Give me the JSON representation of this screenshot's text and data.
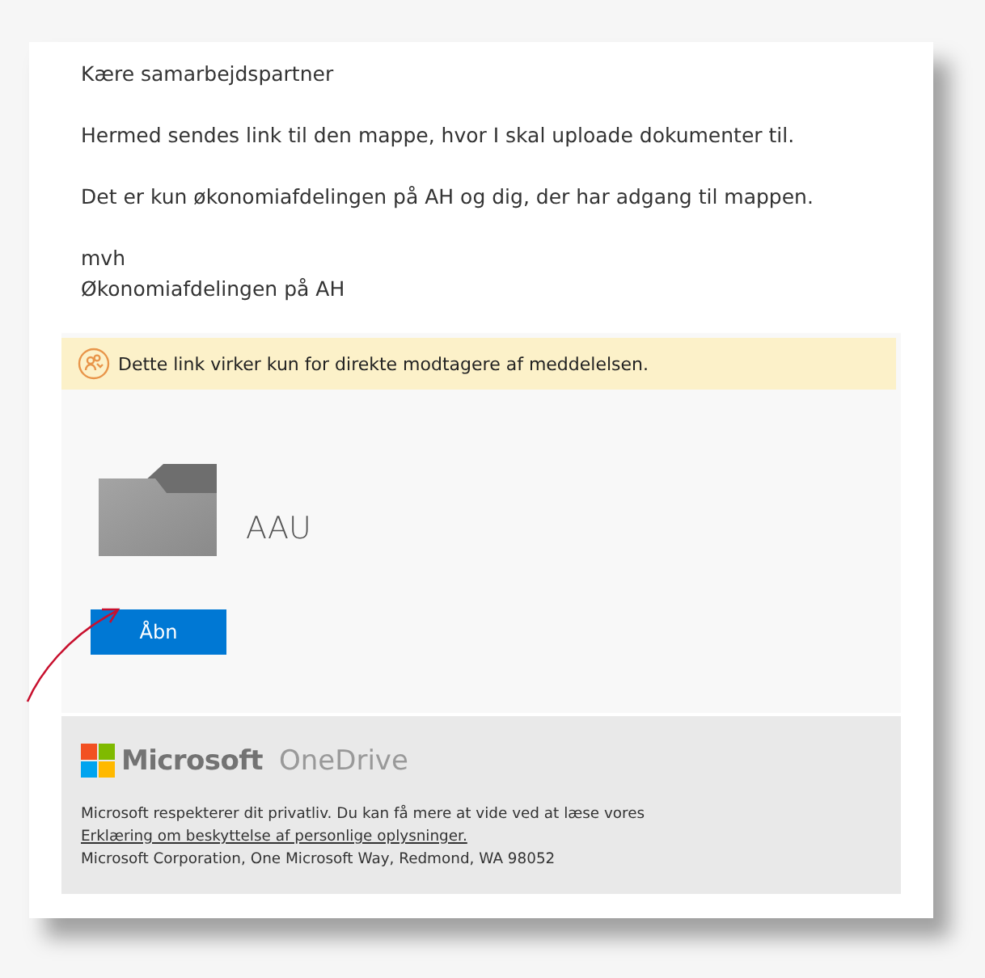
{
  "message": {
    "greeting": "Kære samarbejdspartner",
    "paragraphs": [
      "Hermed sendes link til den mappe, hvor I skal uploade dokumenter til.",
      "Det er kun økonomiafdelingen på AH og dig, der har adgang til mappen."
    ],
    "signoff": [
      "mvh",
      "Økonomiafdelingen på AH"
    ]
  },
  "share_card": {
    "notice": "Dette link virker kun for direkte modtagere af meddelelsen.",
    "folder_name": "AAU",
    "open_button": "Åbn"
  },
  "footer": {
    "brand": "Microsoft",
    "product": "OneDrive",
    "privacy_text": "Microsoft respekterer dit privatliv. Du kan få mere at vide ved at læse vores",
    "privacy_link": "Erklæring om beskyttelse af personlige oplysninger.",
    "address": "Microsoft Corporation, One Microsoft Way, Redmond, WA 98052"
  }
}
